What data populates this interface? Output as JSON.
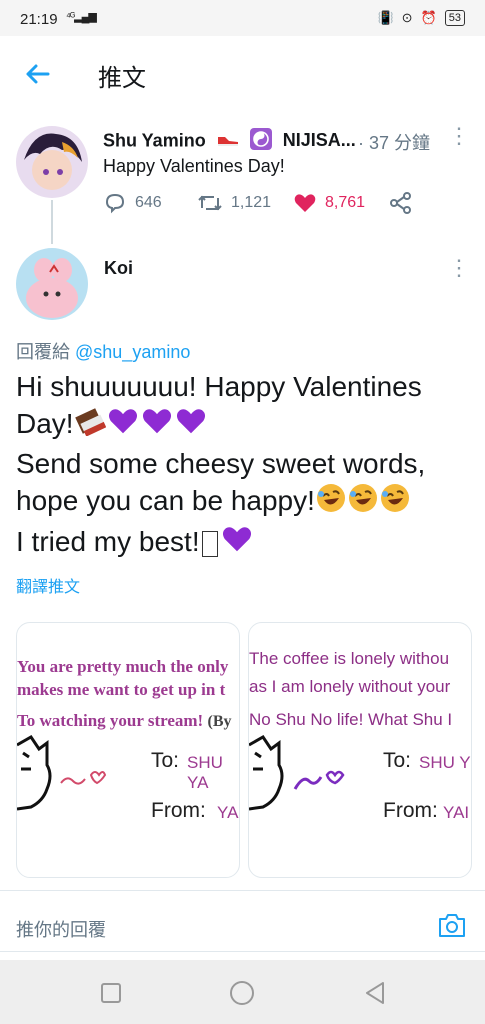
{
  "status_bar": {
    "time": "21:19",
    "signal": "4G",
    "battery": "53"
  },
  "app_bar": {
    "title": "推文"
  },
  "tweet": {
    "author": "Shu Yamino",
    "author_suffix": "NIJISA...",
    "time_ago": "· 37 分鐘",
    "text": "Happy Valentines Day!",
    "replies": "646",
    "retweets": "1,121",
    "likes": "8,761"
  },
  "reply": {
    "author": "Koi",
    "reply_label": "回覆給",
    "reply_handle": "@shu_yamino",
    "line1": "Hi shuuuuuuu! Happy Valentines",
    "line2": "Day!",
    "line3": "Send some cheesy sweet words,",
    "line4": "hope you can be happy!",
    "line5": "I tried my best!",
    "translate": "翻譯推文"
  },
  "cards": [
    {
      "line1": "You are pretty much the only",
      "line2": "makes me want to get up in t",
      "line3": "To watching your stream!",
      "line3_suffix": "(By",
      "to_label": "To:",
      "to_value": "SHU YA",
      "from_label": "From:",
      "from_value": "YA"
    },
    {
      "line1": "The coffee is lonely withou",
      "line2": "as I am lonely without your",
      "line3": "No Shu No life!  What Shu I",
      "to_label": "To:",
      "to_value": "SHU Y",
      "from_label": "From:",
      "from_value": "YAI"
    }
  ],
  "reply_bar": {
    "placeholder": "推你的回覆"
  },
  "colors": {
    "accent": "#1da1f2",
    "like": "#e0245e",
    "purple": "#7b2cbf"
  }
}
